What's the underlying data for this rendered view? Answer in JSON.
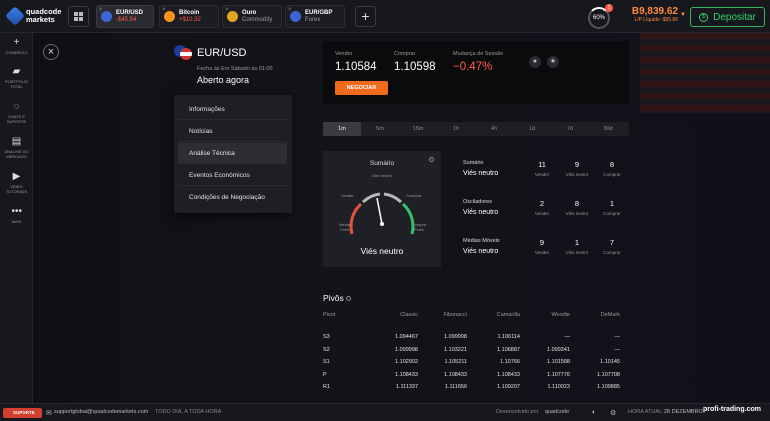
{
  "brand": {
    "name_line1": "quadcode",
    "name_line2": "markets"
  },
  "tabs": [
    {
      "title": "EUR/USD",
      "value": "-$45.54",
      "color": "#3b66d6"
    },
    {
      "title": "Bitcoin",
      "value": "+$10.32",
      "color": "#f7931a"
    },
    {
      "title": "Ouro",
      "value": "Commodity",
      "color": "#e0a420"
    },
    {
      "title": "EUR/GBP",
      "value": "Forex",
      "color": "#3b66d6"
    }
  ],
  "header": {
    "gauge_value": "60%",
    "badge": "1",
    "balance": "B9,839.62",
    "balance_sub": "L/P Líquido -$55.86",
    "deposit_label": "Depositar"
  },
  "sidebar": [
    {
      "icon": "plus-icon",
      "glyph": "+",
      "label": "COMÉRCIO"
    },
    {
      "icon": "portfolio-icon",
      "glyph": "▰",
      "label": "PORTFÓLIO TOTAL"
    },
    {
      "icon": "chat-icon",
      "glyph": "◌",
      "label": "CHATS E SUPORTE"
    },
    {
      "icon": "market-analysis-icon",
      "glyph": "▤",
      "label": "ANÁLISE DO MERCADO"
    },
    {
      "icon": "video-icon",
      "glyph": "▶",
      "label": "VÍDEO TUTORIAIS"
    },
    {
      "icon": "more-icon",
      "glyph": "•••",
      "label": "MAIS"
    }
  ],
  "asset": {
    "name": "EUR/USD",
    "closes": "Fecha às Em Sábado às 01:00",
    "status": "Aberto agora"
  },
  "menu": [
    "Informações",
    "Notícias",
    "Análise Técnica",
    "Eventos Económicos",
    "Condições de Negociação"
  ],
  "quote": {
    "sell_label": "Vender",
    "sell_value": "1.10584",
    "buy_label": "Comprar",
    "buy_value": "1.10598",
    "change_label": "Mudança de Sessão",
    "change_value": "−0.47%",
    "trade_button": "NEGOCIAR"
  },
  "timeframes": [
    "1m",
    "5m",
    "15m",
    "1h",
    "4h",
    "1d",
    "7d",
    "30d"
  ],
  "summary": {
    "title": "Sumário",
    "gauge_labels": {
      "neutral": "Viés neutro",
      "sell": "Vender",
      "buy": "Comprar",
      "strong_sell": "Vender Forte",
      "strong_buy": "Compra Forte"
    },
    "result": "Viés neutro"
  },
  "indicators": [
    {
      "name": "Sumário",
      "result": "Viés neutro",
      "sell": "11",
      "neutral": "9",
      "buy": "8"
    },
    {
      "name": "Osciladores",
      "result": "Viés neutro",
      "sell": "2",
      "neutral": "8",
      "buy": "1"
    },
    {
      "name": "Médias Móveis",
      "result": "Viés neutro",
      "sell": "9",
      "neutral": "1",
      "buy": "7"
    }
  ],
  "indicator_labels": {
    "sell": "Vender",
    "neutral": "Viés neutro",
    "buy": "Comprar"
  },
  "pivots": {
    "title": "Pivôs",
    "headers": [
      "Pivot",
      "Classic",
      "Fibonacci",
      "Camarilla",
      "Woodie",
      "DeMark"
    ],
    "rows": [
      [
        "S3",
        "1.094467",
        "1.099998",
        "1.106114",
        "—",
        "—"
      ],
      [
        "S2",
        "1.099998",
        "1.103221",
        "1.106887",
        "1.099341",
        "—"
      ],
      [
        "S1",
        "1.102902",
        "1.105211",
        "1.10766",
        "1.101588",
        "1.10145"
      ],
      [
        "P",
        "1.108433",
        "1.108433",
        "1.108433",
        "1.107776",
        "1.107708"
      ],
      [
        "R1",
        "1.111337",
        "1.111656",
        "1.109207",
        "1.110023",
        "1.109885"
      ]
    ]
  },
  "statusbar": {
    "support": "SUPORTE",
    "email": "supportglobal@quadcodemarkets.com",
    "hours": "TODO DIA, A TODA HORA",
    "powered": "Desenvolvido por",
    "powered_brand": "quadcode",
    "time_label": "HORA ATUAL:",
    "time_value": "28 DEZEMBRO",
    "watermark": "profi-trading.com"
  }
}
